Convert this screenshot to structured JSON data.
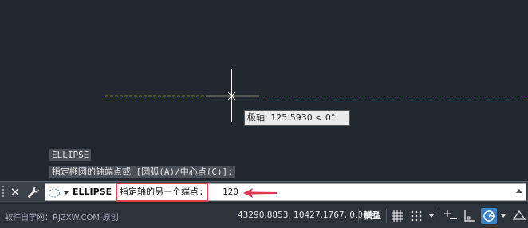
{
  "drawing": {
    "tooltip_text": "极轴: 125.5930 < 0°"
  },
  "command_history": [
    "ELLIPSE",
    "指定椭圆的轴端点或 [圆弧(A)/中心点(C)]:"
  ],
  "command_line": {
    "command_name": "ELLIPSE",
    "prompt": "指定轴的另一个端点:",
    "input_value": "120"
  },
  "status_bar": {
    "watermark": "软件自学网：RJZXW.COM-原创",
    "coordinates": "43290.8853, 10427.1767, 0.0000",
    "model_label": "模型"
  },
  "colors": {
    "canvas_bg": "#212830",
    "ellipse_axis": "#d8e000",
    "tracking_line": "#2ec24a",
    "highlight_box": "#e04050",
    "polar_active": "#3f84c4"
  }
}
